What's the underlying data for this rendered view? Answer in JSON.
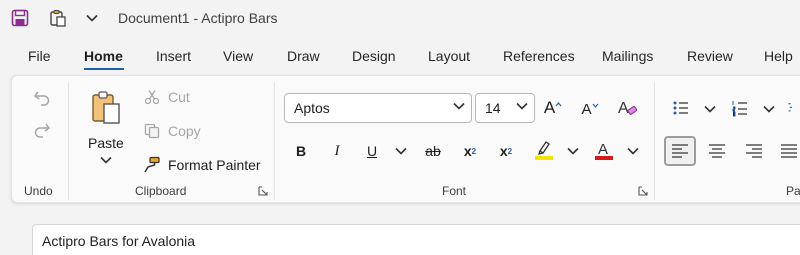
{
  "title_bar": {
    "document_title": "Document1 - Actipro Bars",
    "qat": [
      {
        "name": "save",
        "icon": "save-icon"
      },
      {
        "name": "clipboard",
        "icon": "clipboard-paste-icon"
      },
      {
        "name": "customize",
        "icon": "chevron-down-icon"
      }
    ]
  },
  "tabs": [
    {
      "label": "File"
    },
    {
      "label": "Home",
      "active": true
    },
    {
      "label": "Insert"
    },
    {
      "label": "View"
    },
    {
      "label": "Draw"
    },
    {
      "label": "Design"
    },
    {
      "label": "Layout"
    },
    {
      "label": "References"
    },
    {
      "label": "Mailings"
    },
    {
      "label": "Review"
    },
    {
      "label": "Help"
    }
  ],
  "ribbon": {
    "undo_group": {
      "label": "Undo"
    },
    "clipboard_group": {
      "label": "Clipboard",
      "paste_label": "Paste",
      "cut_label": "Cut",
      "copy_label": "Copy",
      "format_painter_label": "Format Painter"
    },
    "font_group": {
      "label": "Font",
      "font_family": "Aptos",
      "font_size": "14",
      "bold": "B",
      "italic": "I",
      "underline": "U",
      "strikethrough": "ab",
      "subscript": "x",
      "superscript": "x",
      "grow_label": "A",
      "shrink_label": "A",
      "highlight_color": "#f2e600",
      "font_color": "#d31b1b"
    },
    "paragraph_group": {
      "label": "Pa"
    }
  },
  "document": {
    "text": "Actipro Bars for Avalonia"
  },
  "colors": {
    "accent": "#1f5fa8",
    "save_icon": "#8a2d8f"
  }
}
